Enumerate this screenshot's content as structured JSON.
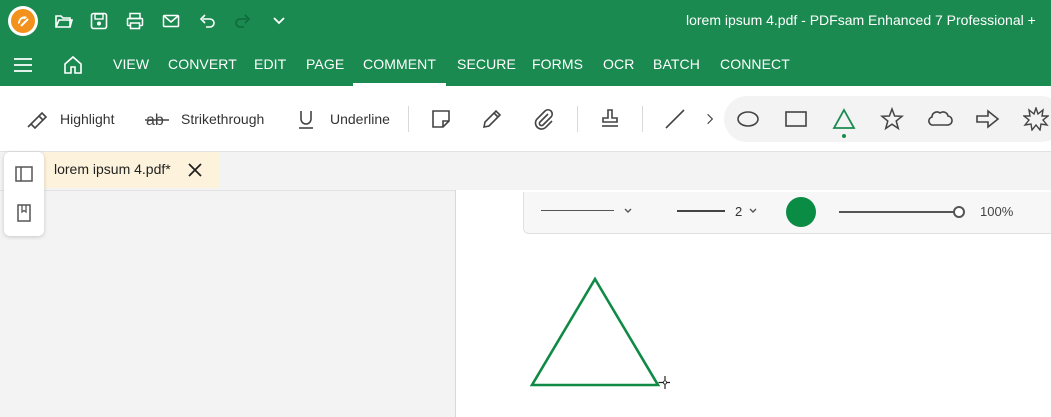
{
  "window": {
    "title": "lorem ipsum 4.pdf   -   PDFsam Enhanced 7 Professional +"
  },
  "colors": {
    "brand": "#1a8a50",
    "accent_orange": "#f2911b",
    "tab_bg": "#fdf3dc",
    "shape_stroke": "#0f8a45"
  },
  "quick_access": {
    "icons": [
      "app-logo-icon",
      "open-folder-icon",
      "save-icon",
      "print-icon",
      "email-icon",
      "undo-icon",
      "redo-icon",
      "chevron-down-icon"
    ]
  },
  "menu": {
    "items": [
      "VIEW",
      "CONVERT",
      "EDIT",
      "PAGE",
      "COMMENT",
      "SECURE",
      "FORMS",
      "OCR",
      "BATCH",
      "CONNECT"
    ],
    "active": "COMMENT"
  },
  "ribbon": {
    "highlight_label": "Highlight",
    "strikethrough_label": "Strikethrough",
    "underline_label": "Underline",
    "tools": [
      "sticky-note-icon",
      "pencil-icon",
      "attachment-icon",
      "stamp-icon",
      "line-icon",
      "more-chevron-icon"
    ],
    "shapes": [
      "ellipse-icon",
      "rectangle-icon",
      "triangle-icon",
      "star-icon",
      "cloud-icon",
      "arrow-icon",
      "burst-icon"
    ],
    "active_shape": "triangle"
  },
  "document_tab": {
    "label": "lorem ipsum 4.pdf*"
  },
  "properties": {
    "line_width": "2",
    "color": "#0b8c45",
    "opacity_value": 1.0,
    "opacity_label": "100%"
  }
}
